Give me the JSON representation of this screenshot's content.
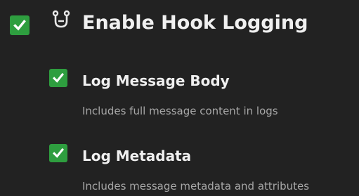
{
  "main_option": {
    "label": "Enable Hook Logging",
    "checked": true,
    "icon": "hook-icon"
  },
  "sub_options": [
    {
      "label": "Log Message Body",
      "description": "Includes full message content in logs",
      "checked": true
    },
    {
      "label": "Log Metadata",
      "description": "Includes message metadata and attributes",
      "checked": true
    }
  ],
  "colors": {
    "background": "#222222",
    "checkbox": "#2e9e3f",
    "label": "#f0f0f0",
    "description": "#a7a7a7"
  }
}
